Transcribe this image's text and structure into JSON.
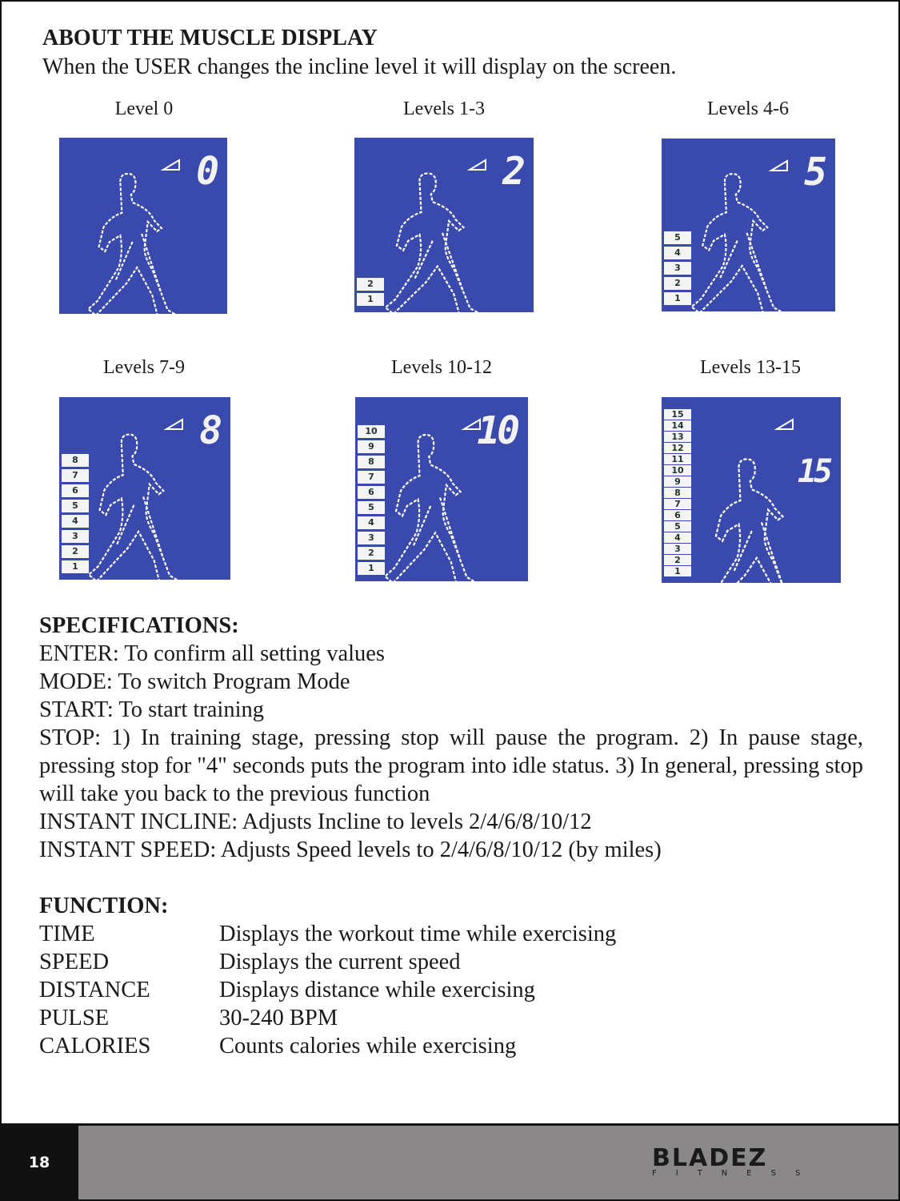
{
  "heading": "ABOUT THE MUSCLE DISPLAY",
  "intro": "When the USER changes the incline level it will display on the screen.",
  "display_color": "#3a49ac",
  "panels": [
    {
      "label": "Level 0",
      "digit": "0",
      "bars": []
    },
    {
      "label": "Levels 1-3",
      "digit": "2",
      "bars": [
        "2",
        "1"
      ]
    },
    {
      "label": "Levels 4-6",
      "digit": "5",
      "bars": [
        "5",
        "4",
        "3",
        "2",
        "1"
      ]
    },
    {
      "label": "Levels 7-9",
      "digit": "8",
      "bars": [
        "8",
        "7",
        "6",
        "5",
        "4",
        "3",
        "2",
        "1"
      ]
    },
    {
      "label": "Levels 10-12",
      "digit": "10",
      "bars": [
        "10",
        "9",
        "8",
        "7",
        "6",
        "5",
        "4",
        "3",
        "2",
        "1"
      ]
    },
    {
      "label": "Levels 13-15",
      "digit": "15",
      "bars": [
        "15",
        "14",
        "13",
        "12",
        "11",
        "10",
        "9",
        "8",
        "7",
        "6",
        "5",
        "4",
        "3",
        "2",
        "1"
      ]
    }
  ],
  "specifications": {
    "title": "SPECIFICATIONS:",
    "lines": [
      "ENTER: To confirm all setting values",
      "MODE: To switch Program Mode",
      "START: To start training",
      "STOP: 1) In training stage, pressing stop will pause the program. 2) In pause stage, pressing stop for \"4\" seconds puts the program into idle status. 3) In general, pressing stop will take you back to the previous function",
      "INSTANT INCLINE: Adjusts Incline to levels 2/4/6/8/10/12",
      "INSTANT SPEED: Adjusts Speed levels to 2/4/6/8/10/12 (by miles)"
    ]
  },
  "function": {
    "title": "FUNCTION:",
    "rows": [
      {
        "name": "TIME",
        "desc": "Displays the workout time while exercising"
      },
      {
        "name": "SPEED",
        "desc": "Displays the current speed"
      },
      {
        "name": "DISTANCE",
        "desc": "Displays distance while exercising"
      },
      {
        "name": "PULSE",
        "desc": "30-240 BPM"
      },
      {
        "name": "CALORIES",
        "desc": "Counts calories while exercising"
      }
    ]
  },
  "footer": {
    "page_number": "18",
    "logo": "BLADEZ",
    "logo_sub": "FITNESS"
  }
}
